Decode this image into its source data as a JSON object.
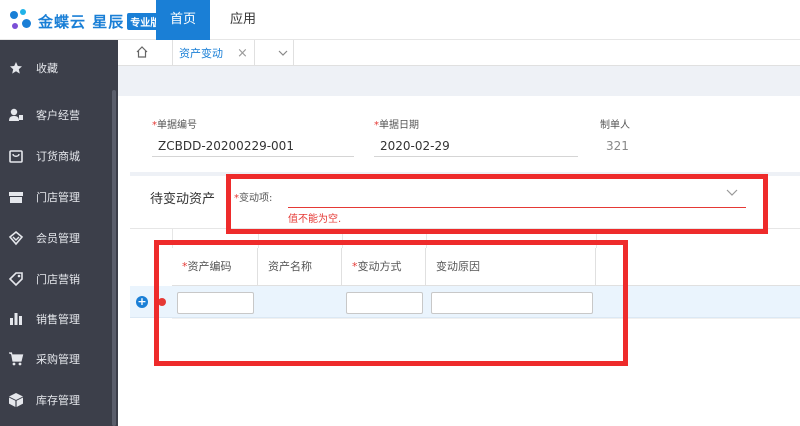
{
  "app": {
    "logo_text": "金蝶云 星辰",
    "logo_badge": "专业版",
    "nav": [
      {
        "label": "首页",
        "active": true
      },
      {
        "label": "应用",
        "active": false
      }
    ],
    "colors": {
      "brand": "#1a7fd6",
      "sidebar": "#3c3f4a",
      "error": "#e53935",
      "annotation": "#ee2b2b"
    }
  },
  "sidebar": {
    "items": [
      {
        "label": "收藏",
        "icon": "star-icon"
      },
      {
        "label": "客户经营",
        "icon": "customer-icon"
      },
      {
        "label": "订货商城",
        "icon": "mall-icon"
      },
      {
        "label": "门店管理",
        "icon": "store-icon"
      },
      {
        "label": "会员管理",
        "icon": "member-icon"
      },
      {
        "label": "门店营销",
        "icon": "tag-icon"
      },
      {
        "label": "销售管理",
        "icon": "bar-chart-icon"
      },
      {
        "label": "采购管理",
        "icon": "cart-icon"
      },
      {
        "label": "库存管理",
        "icon": "box-icon"
      }
    ]
  },
  "tabs": {
    "home_icon": "home-icon",
    "current": {
      "label": "资产变动",
      "close": "×"
    }
  },
  "form": {
    "bill_no": {
      "label": "单据编号",
      "value": "ZCBDD-20200229-001",
      "required": true
    },
    "bill_date": {
      "label": "单据日期",
      "value": "2020-02-29",
      "required": true
    },
    "creator": {
      "label": "制单人",
      "value": "321",
      "required": false
    }
  },
  "pending": {
    "title": "待变动资产",
    "change_item_label": "变动项:",
    "change_item_value": "",
    "error": "值不能为空."
  },
  "table": {
    "columns": [
      {
        "label": "资产编码",
        "required": true
      },
      {
        "label": "资产名称",
        "required": false
      },
      {
        "label": "变动方式",
        "required": true
      },
      {
        "label": "变动原因",
        "required": false
      }
    ],
    "add_label": "+"
  }
}
